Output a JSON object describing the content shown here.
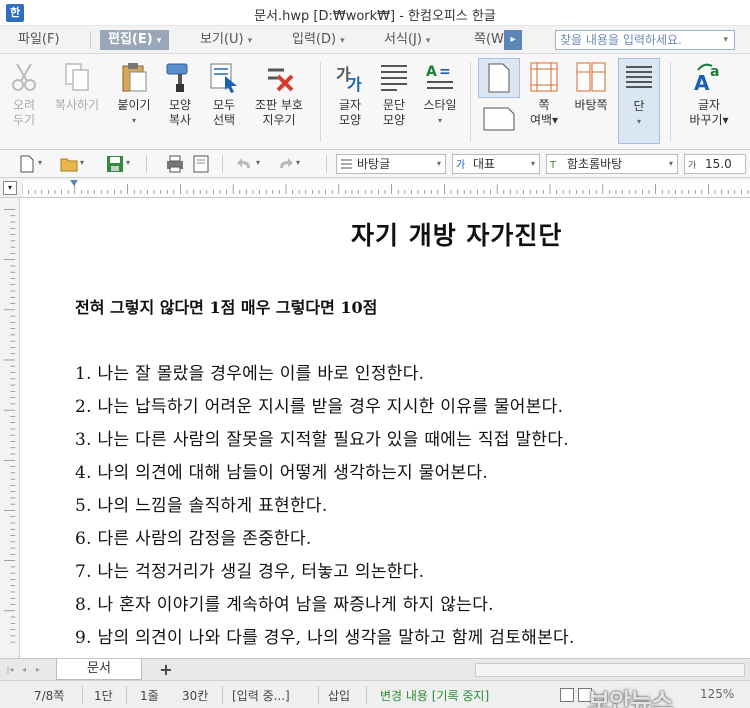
{
  "window": {
    "title": "문서.hwp [D:₩work₩] - 한컴오피스 한글",
    "app_icon": "한"
  },
  "menu": {
    "items": [
      {
        "label": "파일(F)",
        "arrow": ""
      },
      {
        "label": "편집(E)",
        "arrow": "▾"
      },
      {
        "label": "보기(U)",
        "arrow": "▾"
      },
      {
        "label": "입력(D)",
        "arrow": "▾"
      },
      {
        "label": "서식(J)",
        "arrow": "▾"
      },
      {
        "label": "쪽(W)",
        "arrow": ""
      }
    ],
    "overflow_glyph": "▸",
    "search_placeholder": "찾을 내용을 입력하세요."
  },
  "ribbon": {
    "buttons": [
      {
        "label1": "오려",
        "label2": "두기",
        "icon": "scissors-icon",
        "disabled": true
      },
      {
        "label1": "복사하기",
        "label2": "",
        "icon": "copy-icon",
        "disabled": true
      },
      {
        "label1": "붙이기",
        "label2": "▾",
        "icon": "paste-icon",
        "disabled": false
      },
      {
        "label1": "모양",
        "label2": "복사",
        "icon": "format-painter-icon",
        "disabled": false
      },
      {
        "label1": "모두",
        "label2": "선택",
        "icon": "select-all-icon",
        "disabled": false
      },
      {
        "label1": "조판 부호",
        "label2": "지우기",
        "icon": "clear-codes-icon",
        "disabled": false
      },
      {
        "label1": "글자",
        "label2": "모양",
        "icon": "char-shape-icon",
        "disabled": false
      },
      {
        "label1": "문단",
        "label2": "모양",
        "icon": "paragraph-shape-icon",
        "disabled": false
      },
      {
        "label1": "스타일",
        "label2": "▾",
        "icon": "style-icon",
        "disabled": false
      },
      {
        "label1": "쪽",
        "label2": "여백▾",
        "icon": "page-margin-icon",
        "disabled": false
      },
      {
        "label1": "바탕쪽",
        "label2": "",
        "icon": "master-page-icon",
        "disabled": false
      },
      {
        "label1": "단",
        "label2": "▾",
        "icon": "columns-icon",
        "disabled": false
      },
      {
        "label1": "글자",
        "label2": "바꾸기▾",
        "icon": "change-case-icon",
        "disabled": false
      }
    ]
  },
  "toolbar": {
    "style_select": "바탕글",
    "lang_select": "대표",
    "font_select": "함초롬바탕",
    "font_size": "15.0"
  },
  "document": {
    "title": "자기 개방 자가진단",
    "subtitle": "전혀 그렇지 않다면 1점 매우 그렇다면 10점",
    "items": [
      "1. 나는 잘 몰랐을 경우에는 이를 바로 인정한다.",
      "2. 나는 납득하기 어려운 지시를 받을 경우 지시한 이유를 물어본다.",
      "3. 나는 다른 사람의 잘못을 지적할 필요가 있을 때에는 직접 말한다.",
      "4. 나의 의견에 대해 남들이 어떻게 생각하는지 물어본다.",
      "5. 나의 느낌을 솔직하게 표현한다.",
      "6. 다른 사람의 감정을 존중한다.",
      "7. 나는 걱정거리가 생길 경우, 터놓고 의논한다.",
      "8. 나 혼자 이야기를 계속하여 남을 짜증나게 하지 않는다.",
      "9. 남의 의견이 나와 다를 경우, 나의 생각을 말하고 함께 검토해본다."
    ]
  },
  "tabs": {
    "doc_tab": "문서",
    "add_tab": "+"
  },
  "status": {
    "page": "7/8쪽",
    "section": "1단",
    "line": "1줄",
    "column": "30칸",
    "mode": "[입력 중...]",
    "insert": "삽입",
    "track": "변경 내용 [기록 중지]",
    "zoom": "125%",
    "watermark": "보안뉴스"
  },
  "colors": {
    "accent": "#5d86b8",
    "active_menu": "#9aa7b8",
    "status_green": "#2f8c3a"
  }
}
